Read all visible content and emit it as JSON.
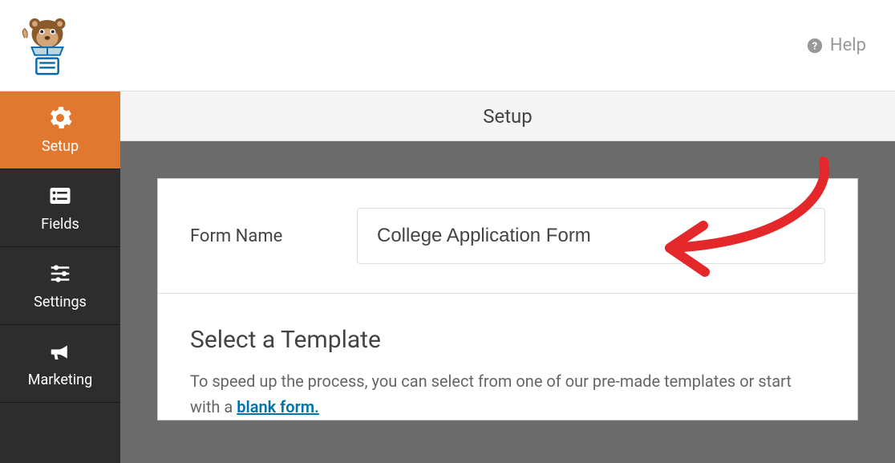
{
  "header": {
    "help_label": "Help"
  },
  "sidebar": {
    "items": [
      {
        "label": "Setup",
        "icon": "gear-icon"
      },
      {
        "label": "Fields",
        "icon": "list-icon"
      },
      {
        "label": "Settings",
        "icon": "sliders-icon"
      },
      {
        "label": "Marketing",
        "icon": "bullhorn-icon"
      }
    ]
  },
  "content": {
    "title": "Setup",
    "form_name_label": "Form Name",
    "form_name_value": "College Application Form",
    "template_heading": "Select a Template",
    "template_desc_pre": "To speed up the process, you can select from one of our pre-made templates or start with a ",
    "template_blank_link": "blank form."
  }
}
